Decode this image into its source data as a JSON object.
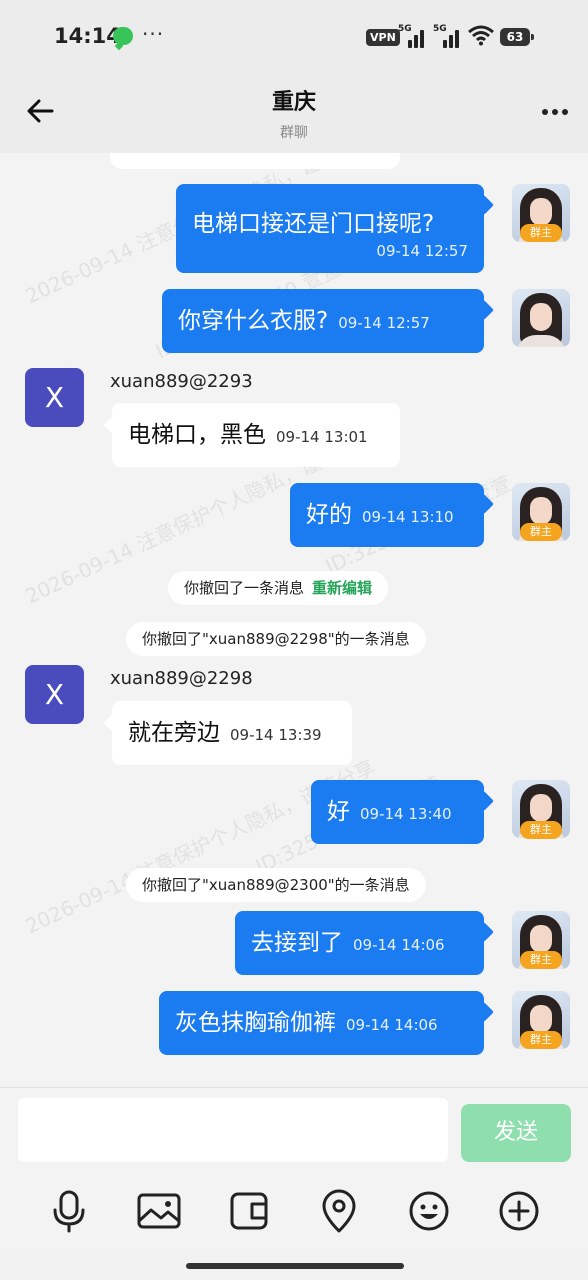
{
  "status_bar": {
    "time": "14:14",
    "more": "···",
    "vpn": "VPN",
    "sim1": "5G",
    "sim2": "5G",
    "battery": "63"
  },
  "header": {
    "title": "重庆",
    "subtitle": "群聊"
  },
  "watermark": {
    "line1": "ID:3258647450 萱萱",
    "line2": "2026-09-14 注意保护个人隐私，谨慎分享"
  },
  "owner_badge": "群主",
  "messages": [
    {
      "text": "电梯口接还是门口接呢?",
      "time": "09-14 12:57"
    },
    {
      "text": "你穿什么衣服?",
      "time": "09-14 12:57"
    },
    {
      "sender": "xuan889@2293",
      "avatar": "X",
      "text": "电梯口，黑色",
      "time": "09-14 13:01"
    },
    {
      "text": "好的",
      "time": "09-14 13:10"
    },
    {
      "system": "你撤回了一条消息",
      "action": "重新编辑"
    },
    {
      "system": "你撤回了\"xuan889@2298\"的一条消息"
    },
    {
      "sender": "xuan889@2298",
      "avatar": "X",
      "text": "就在旁边",
      "time": "09-14 13:39"
    },
    {
      "text": "好",
      "time": "09-14 13:40"
    },
    {
      "system": "你撤回了\"xuan889@2300\"的一条消息"
    },
    {
      "text": "去接到了",
      "time": "09-14 14:06"
    },
    {
      "text": "灰色抹胸瑜伽裤",
      "time": "09-14 14:06"
    }
  ],
  "composer": {
    "input_value": "",
    "send_label": "发送"
  },
  "toolbar": {
    "icons": [
      "microphone-icon",
      "image-icon",
      "wallet-icon",
      "location-icon",
      "emoji-icon",
      "plus-icon"
    ]
  }
}
